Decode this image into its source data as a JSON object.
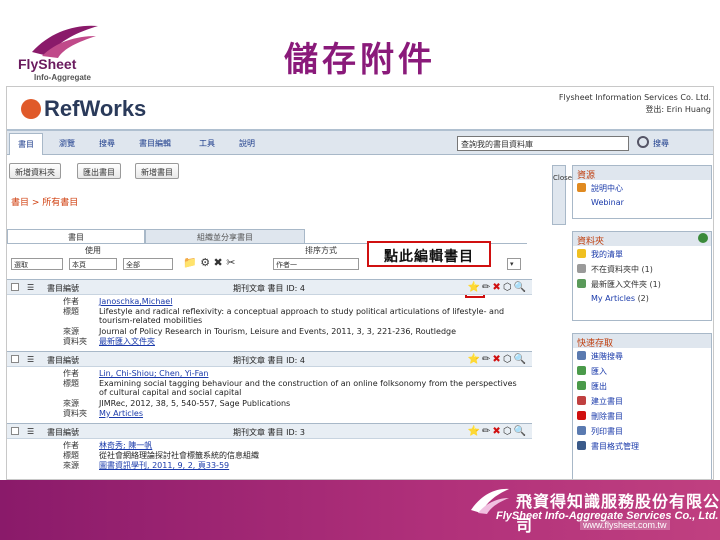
{
  "slide": {
    "title": "儲存附件",
    "logo_brand": "FlySheet",
    "logo_tag": "Info-Aggregate",
    "callout": "點此編輯書目"
  },
  "app": {
    "name": "RefWorks",
    "institution": "Flysheet Information Services Co. Ltd.",
    "user": "登出: Erin Huang",
    "menu": [
      "書目",
      "瀏覽",
      "搜尋",
      "書目編輯",
      "工具",
      "說明"
    ],
    "search_placeholder": "查詢我的書目資料庫",
    "search_go": "搜尋",
    "buttons": [
      "新增資料夾",
      "匯出書目",
      "新增書目"
    ],
    "breadcrumb": "書目 > 所有書目",
    "collapse_label": "Close",
    "tabs": [
      "書目",
      "組織並分享書目"
    ],
    "toolbar": {
      "use_label": "使用",
      "format_label": "排序方式",
      "select_options": [
        "選取",
        "本頁",
        "全部"
      ],
      "sort_value": "作者一"
    }
  },
  "references": [
    {
      "type": "書目編號",
      "ref_id": "期刊文章 書目 ID: 4",
      "rows": [
        {
          "k": "作者",
          "v": "Janoschka,Michael",
          "link": true
        },
        {
          "k": "標題",
          "v": "Lifestyle and radical reflexivity: a conceptual approach to study political articulations of lifestyle- and tourism-related mobilities",
          "link": false
        },
        {
          "k": "來源",
          "v": "Journal of Policy Research in Tourism, Leisure and Events, 2011, 3, 3, 221-236, Routledge",
          "link": false
        },
        {
          "k": "資料夾",
          "v": "最新匯入文件夾",
          "link": true
        }
      ]
    },
    {
      "type": "書目編號",
      "ref_id": "期刊文章 書目 ID: 4",
      "rows": [
        {
          "k": "作者",
          "v": "Lin, Chi-Shiou; Chen, Yi-Fan",
          "link": true
        },
        {
          "k": "標題",
          "v": "Examining social tagging behaviour and the construction of an online folksonomy from the perspectives of cultural capital and social capital",
          "link": false
        },
        {
          "k": "來源",
          "v": "JIMRec, 2012, 38, 5, 540-557, Sage Publications",
          "link": false
        },
        {
          "k": "資料夾",
          "v": "My Articles",
          "link": true
        }
      ]
    },
    {
      "type": "書目編號",
      "ref_id": "期刊文章 書目 ID: 3",
      "rows": [
        {
          "k": "作者",
          "v": "林奇秀; 陳一帆",
          "link": true
        },
        {
          "k": "標題",
          "v": "從社會網絡理論探討社會標籤系統的信息組織",
          "link": false
        },
        {
          "k": "來源",
          "v": "圖書資訊學刊, 2011, 9, 2, 頁33-59",
          "link": false
        }
      ]
    }
  ],
  "sidebar": {
    "resources": {
      "title": "資源",
      "items": [
        "說明中心",
        "Webinar"
      ]
    },
    "folders": {
      "title": "資料夾",
      "items": [
        {
          "label": "我的清單",
          "count": ""
        },
        {
          "label": "不在資料夾中",
          "count": "(1)"
        },
        {
          "label": "最新匯入文件夾",
          "count": "(1)"
        },
        {
          "label": "My Articles",
          "count": "(2)"
        }
      ]
    },
    "quick": {
      "title": "快速存取",
      "items": [
        "進階搜尋",
        "匯入",
        "匯出",
        "建立書目",
        "刪除書目",
        "列印書目",
        "書目格式管理"
      ]
    }
  },
  "footer": {
    "company_zh": "飛資得知識服務股份有限公司",
    "company_en": "FlySheet Info-Aggregate Services Co., Ltd.",
    "url": "www.flysheet.com.tw"
  },
  "colors": {
    "title_purple": "#8a1a7a",
    "footer_magenta": "#a02872",
    "callout_red": "#d01010",
    "link_blue": "#1a3aaa",
    "accent_orange": "#d04010"
  }
}
